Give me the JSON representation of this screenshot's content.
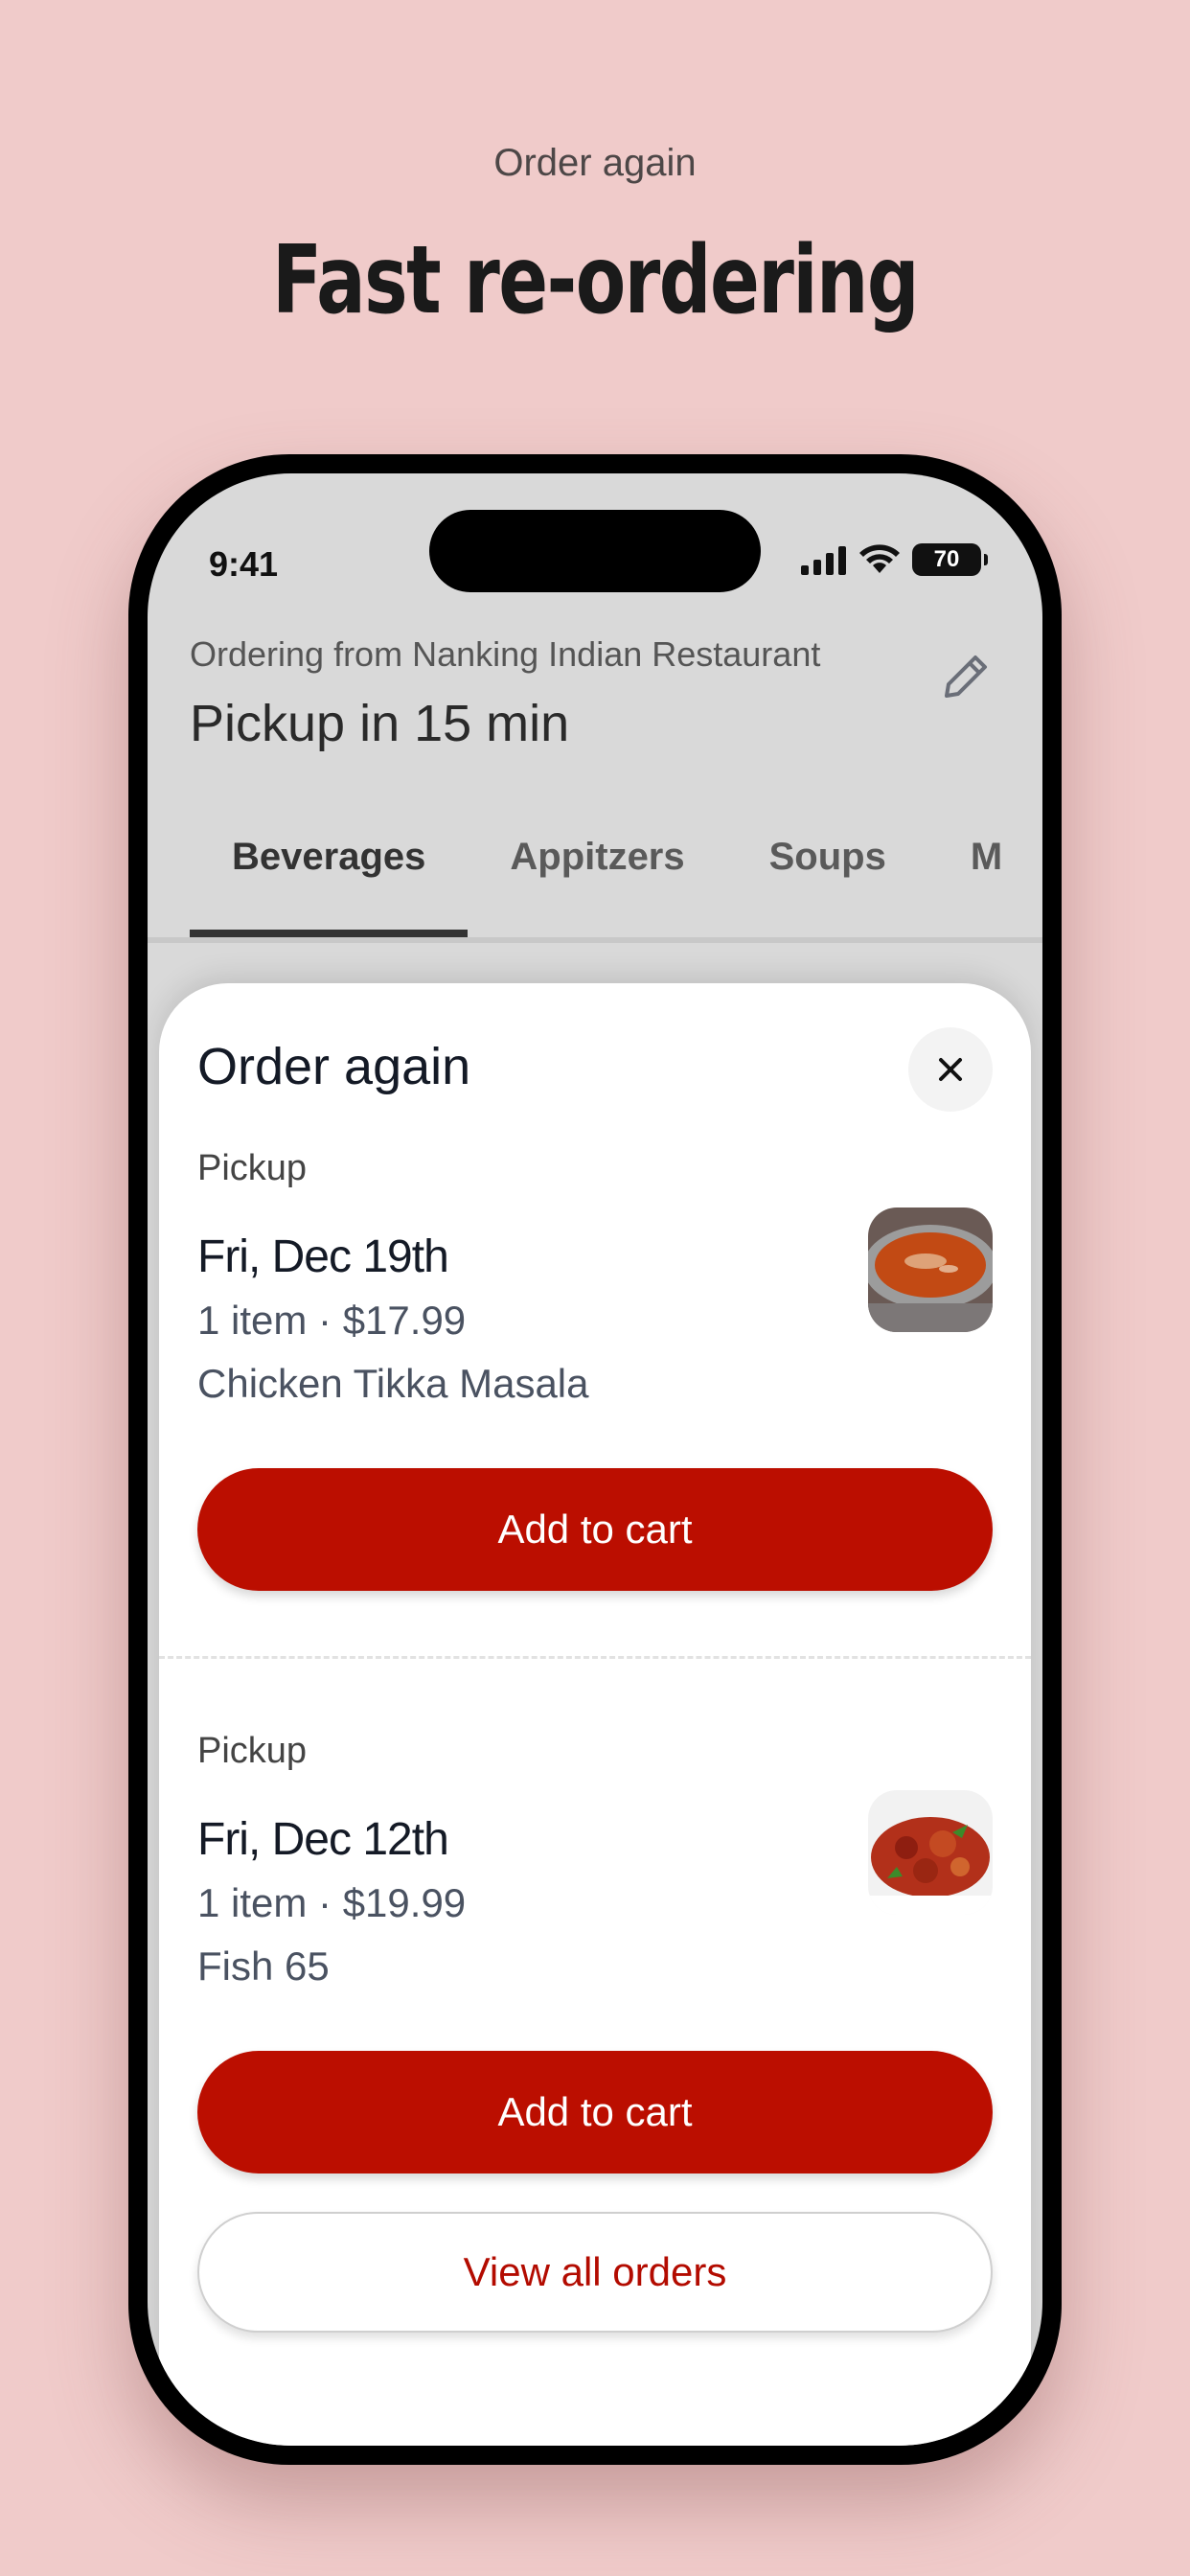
{
  "promo": {
    "subtitle": "Order again",
    "title": "Fast re-ordering"
  },
  "status_bar": {
    "time": "9:41",
    "battery": "70"
  },
  "header": {
    "ordering_from": "Ordering from Nanking Indian Restaurant",
    "pickup": "Pickup in 15 min",
    "edit_icon": "pencil-icon"
  },
  "tabs": [
    {
      "label": "Beverages",
      "active": true
    },
    {
      "label": "Appitzers",
      "active": false
    },
    {
      "label": "Soups",
      "active": false
    },
    {
      "label": "M",
      "active": false
    }
  ],
  "sheet": {
    "title": "Order again",
    "close_icon": "close-icon",
    "orders": [
      {
        "type": "Pickup",
        "date": "Fri, Dec 19th",
        "summary": "1 item · $17.99",
        "item": "Chicken Tikka Masala",
        "button": "Add to cart"
      },
      {
        "type": "Pickup",
        "date": "Fri, Dec 12th",
        "summary": "1 item · $19.99",
        "item": "Fish 65",
        "button": "Add to cart"
      }
    ],
    "view_all": "View all orders"
  },
  "colors": {
    "background": "#f0cbca",
    "accent": "#bb0e00"
  }
}
